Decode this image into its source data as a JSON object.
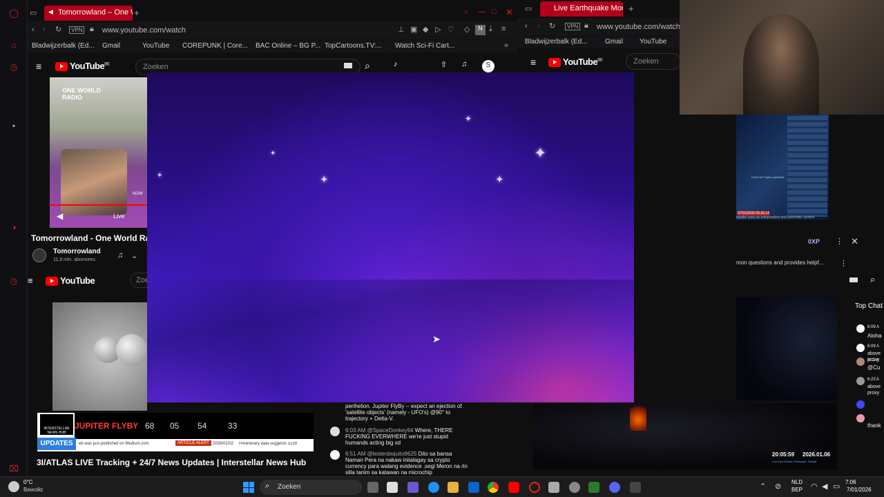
{
  "left_browser": {
    "tab_title": "Tomorrowland – One W",
    "url": "www.youtube.com/watch",
    "vpn": "VPN",
    "bookmarks": [
      "Bladwijzerbalk (Ed...",
      "Gmail",
      "YouTube",
      "COREPUNK | Core...",
      "BAC Online – BG P...",
      "TopCartoons.TV:...",
      "Watch Sci-Fi Cart..."
    ],
    "search_placeholder": "Zoeken",
    "yt_country": "BE",
    "yt_logo": "YouTube",
    "avatar_letter": "S",
    "live_label": "Live",
    "now_label": "NOW",
    "radio_label": "ONE WORLD RADIO",
    "video_title": "Tomorrowland - One World Radi",
    "channel": "Tomorrowland",
    "subs": "11,9 mln. abonnees",
    "second_logo": "YouTube",
    "second_search": "Zoe",
    "jupiter_label": "JUPITER FLYBY",
    "countdown": [
      "68",
      "05",
      "54",
      "33"
    ],
    "interstellar": "INTERSTELLAR NEWS HUB",
    "updates": "UPDATES",
    "ticker_text": "eb was just published on Medium.com",
    "article_alert": "ARTICLE ALERT",
    "ticker_date": "2026/01/02",
    "ticker_text2": "Preliminary data suggests 1239",
    "bottom_title": "3I/ATLAS LIVE Tracking + 24/7 News Updates | Interstellar News Hub"
  },
  "chat_msgs": [
    {
      "time": "",
      "user": "",
      "text": "perihelion. Jupiter FlyBy -- expect an ejection of 'satellite objects' (namely - UFO's) @90° to trajectory + Delta-V."
    },
    {
      "time": "6:03 AM",
      "user": "@SpaceDonkey94",
      "text": "Where, THERE FUCKING EVERWHERE we're just stupid humands acting big xd"
    },
    {
      "time": "6:51 AM",
      "user": "@lesterdequito9625",
      "text": "Dito sa bansa Naman Pera na nakaw iniialagay sa crypto currency para walang evidence ,segi Meron na rin silla tanim sa katawan na microchip"
    }
  ],
  "right_browser": {
    "tab_title": "Live Earthquake Monitorin",
    "url": "www.youtube.com/watch",
    "vpn": "VPN",
    "bookmarks": [
      "Bladwijzerbalk (Ed...",
      "Gmail",
      "YouTube"
    ],
    "yt_logo": "YouTube",
    "yt_country": "BE",
    "search_placeholder": "Zoeken",
    "xp": "0XP",
    "assistant_text": "mon questions and provides helpf...",
    "quake_caption": "Fault Line Types (updated)",
    "quake_footer": "07/01/2026 05:25:14",
    "quake_sub": "rquake uses an independent and automatic system",
    "top_chat": "Top Chat",
    "chat_snips": [
      {
        "time": "6:09 A",
        "text": "Aloha"
      },
      {
        "time": "6:09 A",
        "text": "above proxy"
      },
      {
        "time": "6:11 A",
        "text": "@Cu"
      },
      {
        "time": "6:23 A",
        "text": "above proxy"
      },
      {
        "time": "6:25 A",
        "text": "thank"
      }
    ],
    "sky_time": "20:05:59",
    "sky_date": "2026.01.06",
    "sky_caption": "Live from Subaru Telescope, Hawaii"
  },
  "taskbar": {
    "weather_temp": "0°C",
    "weather_text": "Bewolkt",
    "search": "Zoeken",
    "lang1": "NLD",
    "lang2": "BEP",
    "time": "7:06",
    "date": "7/01/2026"
  },
  "colors": {
    "accent": "#b3001b",
    "youtube_red": "#ff0000",
    "overlay_top": "#1d0a5c",
    "overlay_bottom": "#6a2be0"
  }
}
